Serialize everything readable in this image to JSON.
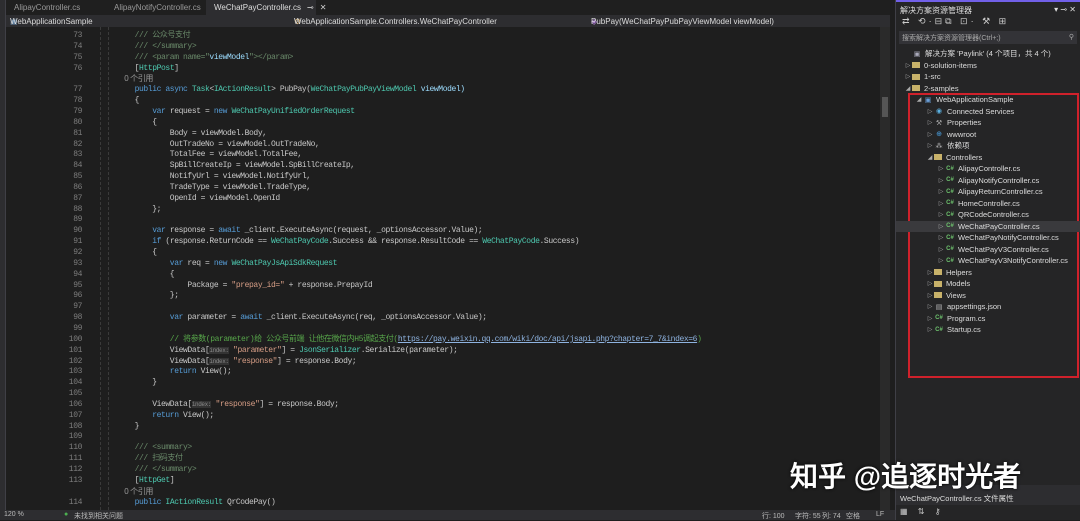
{
  "tabs": [
    "AlipayController.cs",
    "AlipayNotifyController.cs",
    "WeChatPayController.cs"
  ],
  "nav": {
    "project": "WebApplicationSample",
    "class": "WebApplicationSample.Controllers.WeChatPayController",
    "member": "PubPay(WeChatPayPubPayViewModel viewModel)"
  },
  "code": [
    {
      "n": "73",
      "t": [
        [
          "    /// 公众号支付",
          "cmx"
        ]
      ]
    },
    {
      "n": "74",
      "t": [
        [
          "    /// </summary>",
          "cmx"
        ]
      ]
    },
    {
      "n": "75",
      "t": [
        [
          "    /// <param name=\"",
          "cmx"
        ],
        [
          "viewModel",
          "id"
        ],
        [
          "\"></param>",
          "cmx"
        ]
      ]
    },
    {
      "n": "76",
      "t": [
        [
          "    [",
          "pl"
        ],
        [
          "HttpPost",
          "ty"
        ],
        [
          "]",
          "pl"
        ]
      ]
    },
    {
      "n": "",
      "lens": "0 个引用"
    },
    {
      "n": "77",
      "t": [
        [
          "    public async ",
          "kw"
        ],
        [
          "Task",
          "ty"
        ],
        [
          "<",
          "pl"
        ],
        [
          "IActionResult",
          "ty"
        ],
        [
          "> PubPay(",
          "pl"
        ],
        [
          "WeChatPayPubPayViewModel",
          "ty"
        ],
        [
          " viewModel)",
          "id"
        ]
      ]
    },
    {
      "n": "78",
      "t": [
        [
          "    {",
          "pl"
        ]
      ]
    },
    {
      "n": "79",
      "t": [
        [
          "        var",
          "kw"
        ],
        [
          " request = ",
          "pl"
        ],
        [
          "new ",
          "kw"
        ],
        [
          "WeChatPayUnifiedOrderRequest",
          "ty"
        ]
      ]
    },
    {
      "n": "80",
      "t": [
        [
          "        {",
          "pl"
        ]
      ]
    },
    {
      "n": "81",
      "t": [
        [
          "            Body = viewModel.Body,",
          "pl"
        ]
      ]
    },
    {
      "n": "82",
      "t": [
        [
          "            OutTradeNo = viewModel.OutTradeNo,",
          "pl"
        ]
      ]
    },
    {
      "n": "83",
      "t": [
        [
          "            TotalFee = viewModel.TotalFee,",
          "pl"
        ]
      ]
    },
    {
      "n": "84",
      "t": [
        [
          "            SpBillCreateIp = viewModel.SpBillCreateIp,",
          "pl"
        ]
      ]
    },
    {
      "n": "85",
      "t": [
        [
          "            NotifyUrl = viewModel.NotifyUrl,",
          "pl"
        ]
      ]
    },
    {
      "n": "86",
      "t": [
        [
          "            TradeType = viewModel.TradeType,",
          "pl"
        ]
      ]
    },
    {
      "n": "87",
      "t": [
        [
          "            OpenId = viewModel.OpenId",
          "pl"
        ]
      ]
    },
    {
      "n": "88",
      "t": [
        [
          "        };",
          "pl"
        ]
      ]
    },
    {
      "n": "89",
      "t": []
    },
    {
      "n": "90",
      "t": [
        [
          "        var",
          "kw"
        ],
        [
          " response = ",
          "pl"
        ],
        [
          "await",
          "kw"
        ],
        [
          " _client.ExecuteAsync(request, _optionsAccessor.Value);",
          "pl"
        ]
      ]
    },
    {
      "n": "91",
      "t": [
        [
          "        if",
          "kw"
        ],
        [
          " (response.ReturnCode == ",
          "pl"
        ],
        [
          "WeChatPayCode",
          "ty"
        ],
        [
          ".Success && response.ResultCode == ",
          "pl"
        ],
        [
          "WeChatPayCode",
          "ty"
        ],
        [
          ".Success)",
          "pl"
        ]
      ]
    },
    {
      "n": "92",
      "t": [
        [
          "        {",
          "pl"
        ]
      ]
    },
    {
      "n": "93",
      "t": [
        [
          "            var",
          "kw"
        ],
        [
          " req = ",
          "pl"
        ],
        [
          "new ",
          "kw"
        ],
        [
          "WeChatPayJsApiSdkRequest",
          "ty"
        ]
      ]
    },
    {
      "n": "94",
      "t": [
        [
          "            {",
          "pl"
        ]
      ]
    },
    {
      "n": "95",
      "t": [
        [
          "                Package = ",
          "pl"
        ],
        [
          "\"prepay_id=\"",
          "str"
        ],
        [
          " + response.PrepayId",
          "pl"
        ]
      ]
    },
    {
      "n": "96",
      "t": [
        [
          "            };",
          "pl"
        ]
      ]
    },
    {
      "n": "97",
      "t": []
    },
    {
      "n": "98",
      "t": [
        [
          "            var",
          "kw"
        ],
        [
          " parameter = ",
          "pl"
        ],
        [
          "await",
          "kw"
        ],
        [
          " _client.ExecuteAsync(req, _optionsAccessor.Value);",
          "pl"
        ]
      ]
    },
    {
      "n": "99",
      "t": []
    },
    {
      "n": "100",
      "t": [
        [
          "            // 将参数(parameter)给 公众号前端 让他在微信内H5调起支付(",
          "cm"
        ],
        [
          "https://pay.weixin.qq.com/wiki/doc/api/jsapi.php?chapter=7_7&index=6",
          "lk"
        ],
        [
          ")",
          "cm"
        ]
      ]
    },
    {
      "n": "101",
      "t": [
        [
          "            ViewData[",
          "pl"
        ],
        [
          "index:",
          "hint"
        ],
        [
          " \"parameter\"",
          "str"
        ],
        [
          "] = ",
          "pl"
        ],
        [
          "JsonSerializer",
          "ty"
        ],
        [
          ".Serialize(parameter);",
          "pl"
        ]
      ]
    },
    {
      "n": "102",
      "t": [
        [
          "            ViewData[",
          "pl"
        ],
        [
          "index:",
          "hint"
        ],
        [
          " \"response\"",
          "str"
        ],
        [
          "] = response.Body;",
          "pl"
        ]
      ]
    },
    {
      "n": "103",
      "t": [
        [
          "            return ",
          "kw"
        ],
        [
          "View();",
          "pl"
        ]
      ]
    },
    {
      "n": "104",
      "t": [
        [
          "        }",
          "pl"
        ]
      ]
    },
    {
      "n": "105",
      "t": []
    },
    {
      "n": "106",
      "t": [
        [
          "        ViewData[",
          "pl"
        ],
        [
          "index:",
          "hint"
        ],
        [
          " \"response\"",
          "str"
        ],
        [
          "] = response.Body;",
          "pl"
        ]
      ]
    },
    {
      "n": "107",
      "t": [
        [
          "        return ",
          "kw"
        ],
        [
          "View();",
          "pl"
        ]
      ]
    },
    {
      "n": "108",
      "t": [
        [
          "    }",
          "pl"
        ]
      ]
    },
    {
      "n": "109",
      "t": []
    },
    {
      "n": "110",
      "t": [
        [
          "    /// <summary>",
          "cmx"
        ]
      ]
    },
    {
      "n": "111",
      "t": [
        [
          "    /// 扫码支付",
          "cmx"
        ]
      ]
    },
    {
      "n": "112",
      "t": [
        [
          "    /// </summary>",
          "cmx"
        ]
      ]
    },
    {
      "n": "113",
      "t": [
        [
          "    [",
          "pl"
        ],
        [
          "HttpGet",
          "ty"
        ],
        [
          "]",
          "pl"
        ]
      ]
    },
    {
      "n": "",
      "lens": "0 个引用"
    },
    {
      "n": "114",
      "t": [
        [
          "    public ",
          "kw"
        ],
        [
          "IActionResult",
          "ty"
        ],
        [
          " QrCodePay()",
          "pl"
        ]
      ]
    }
  ],
  "status": {
    "zoom": "120 %",
    "issues": "未找到相关问题",
    "line": "行: 100",
    "char": "字符: 55",
    "col": "列: 74",
    "ws": "空格",
    "eol": "LF"
  },
  "solution_explorer": {
    "title": "解决方案资源管理器",
    "search_placeholder": "搜索解决方案资源管理器(Ctrl+;)",
    "items": [
      {
        "label": "解决方案 'Paylink' (4 个项目，共 4 个)",
        "level": 0,
        "icon": "solution",
        "arrow": ""
      },
      {
        "label": "0-solution-items",
        "level": 0,
        "icon": "folder",
        "arrow": "▷"
      },
      {
        "label": "1-src",
        "level": 0,
        "icon": "folder",
        "arrow": "▷"
      },
      {
        "label": "2-samples",
        "level": 0,
        "icon": "folder",
        "arrow": "◢"
      },
      {
        "label": "WebApplicationSample",
        "level": 1,
        "icon": "project",
        "arrow": "◢"
      },
      {
        "label": "Connected Services",
        "level": 2,
        "icon": "connected",
        "arrow": "▷"
      },
      {
        "label": "Properties",
        "level": 2,
        "icon": "properties",
        "arrow": "▷"
      },
      {
        "label": "wwwroot",
        "level": 2,
        "icon": "globe",
        "arrow": "▷"
      },
      {
        "label": "依赖项",
        "level": 2,
        "icon": "dependencies",
        "arrow": "▷"
      },
      {
        "label": "Controllers",
        "level": 2,
        "icon": "folder",
        "arrow": "◢"
      },
      {
        "label": "AlipayController.cs",
        "level": 3,
        "icon": "cs",
        "arrow": "▷"
      },
      {
        "label": "AlipayNotifyController.cs",
        "level": 3,
        "icon": "cs",
        "arrow": "▷"
      },
      {
        "label": "AlipayReturnController.cs",
        "level": 3,
        "icon": "cs",
        "arrow": "▷"
      },
      {
        "label": "HomeController.cs",
        "level": 3,
        "icon": "cs",
        "arrow": "▷"
      },
      {
        "label": "QRCodeController.cs",
        "level": 3,
        "icon": "cs",
        "arrow": "▷"
      },
      {
        "label": "WeChatPayController.cs",
        "level": 3,
        "icon": "cs",
        "arrow": "▷",
        "selected": true
      },
      {
        "label": "WeChatPayNotifyController.cs",
        "level": 3,
        "icon": "cs",
        "arrow": "▷"
      },
      {
        "label": "WeChatPayV3Controller.cs",
        "level": 3,
        "icon": "cs",
        "arrow": "▷"
      },
      {
        "label": "WeChatPayV3NotifyController.cs",
        "level": 3,
        "icon": "cs",
        "arrow": "▷"
      },
      {
        "label": "Helpers",
        "level": 2,
        "icon": "folder",
        "arrow": "▷"
      },
      {
        "label": "Models",
        "level": 2,
        "icon": "folder",
        "arrow": "▷"
      },
      {
        "label": "Views",
        "level": 2,
        "icon": "folder",
        "arrow": "▷"
      },
      {
        "label": "appsettings.json",
        "level": 2,
        "icon": "json",
        "arrow": "▷"
      },
      {
        "label": "Program.cs",
        "level": 2,
        "icon": "cs",
        "arrow": "▷"
      },
      {
        "label": "Startup.cs",
        "level": 2,
        "icon": "cs",
        "arrow": "▷"
      }
    ]
  },
  "properties": {
    "title": "WeChatPayController.cs 文件属性"
  },
  "watermark": "知乎 @追逐时光者",
  "colors": {
    "highlight_box": "#d0212b",
    "accent": "#7160e8"
  }
}
